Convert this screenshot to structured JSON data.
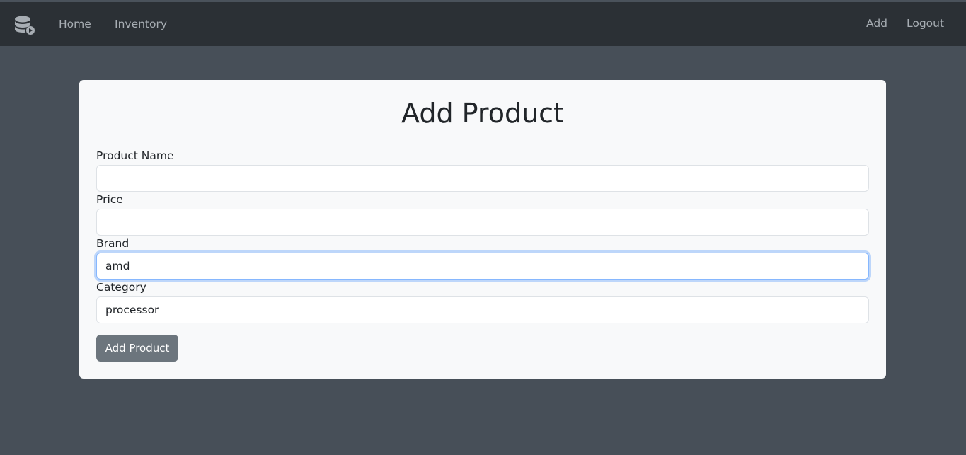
{
  "navbar": {
    "brand_icon": "database-icon",
    "links_left": [
      "Home",
      "Inventory"
    ],
    "links_right": [
      "Add",
      "Logout"
    ]
  },
  "form": {
    "title": "Add Product",
    "fields": [
      {
        "label": "Product Name",
        "value": ""
      },
      {
        "label": "Price",
        "value": ""
      },
      {
        "label": "Brand",
        "value": "amd",
        "focused": true
      },
      {
        "label": "Category",
        "value": "processor"
      }
    ],
    "submit_label": "Add Product"
  },
  "colors": {
    "page_background": "#474f58",
    "navbar_background": "#2b3035",
    "card_background": "#f8f9fa",
    "button_background": "#6c757d",
    "focus_border": "#86b7fe"
  }
}
